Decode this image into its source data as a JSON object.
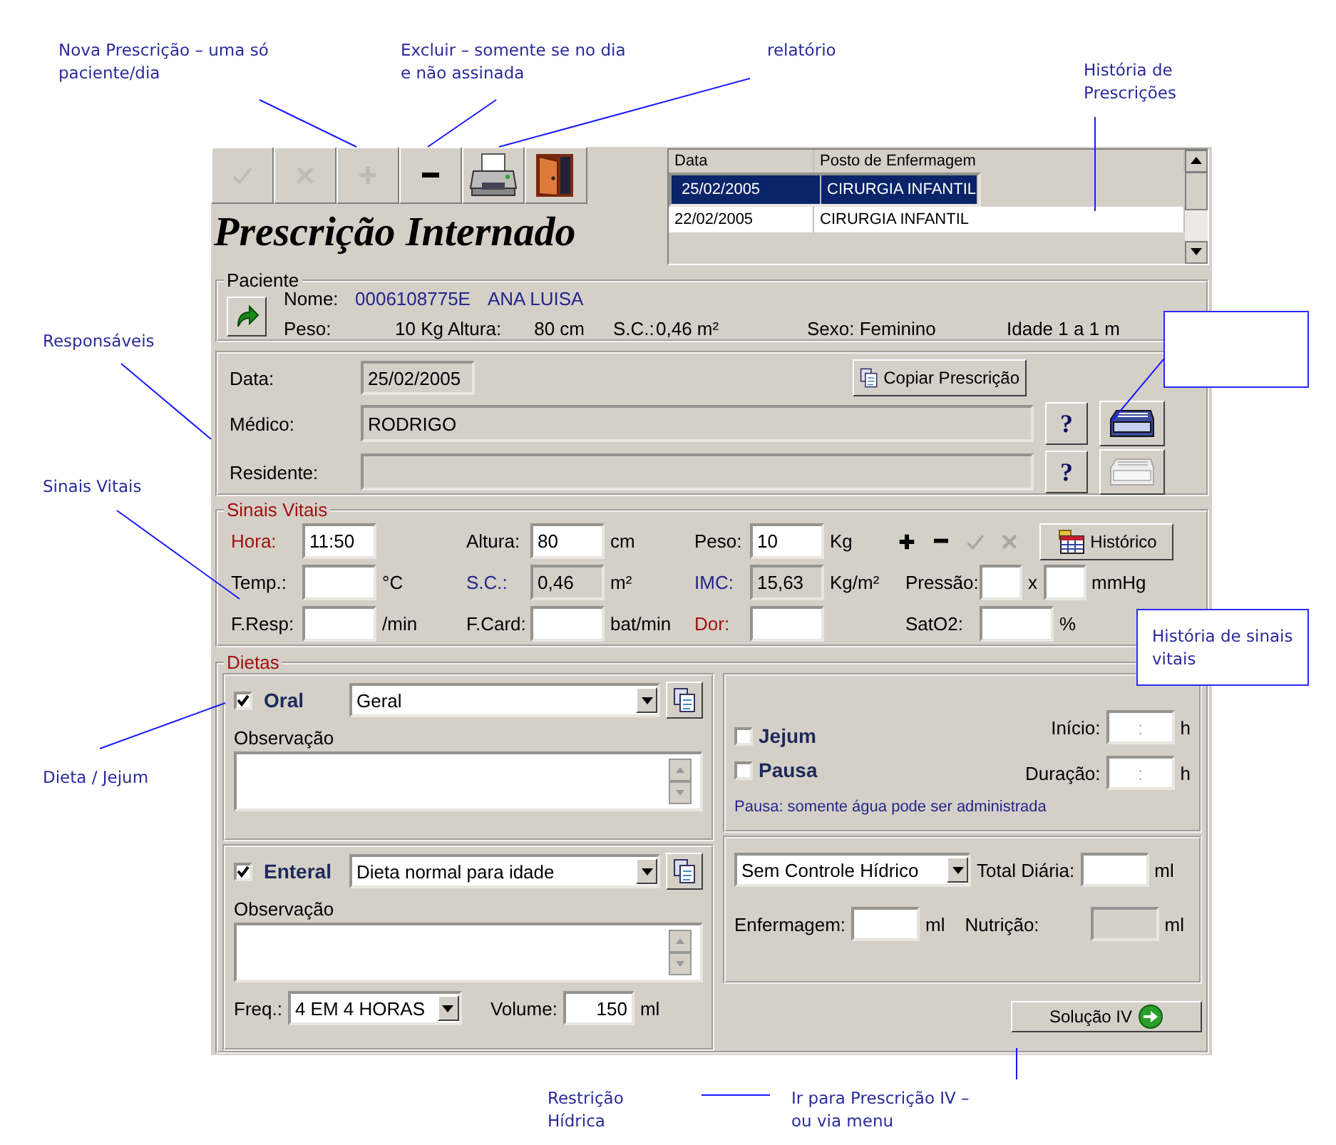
{
  "annotations": [
    {
      "text": "Nova Prescrição – uma só paciente/dia",
      "kind": "plain"
    },
    {
      "text": "Excluir – somente se no dia e não assinada",
      "kind": "plain"
    },
    {
      "text": "relatório",
      "kind": "plain"
    },
    {
      "text": "História de Prescrições",
      "kind": "plain"
    },
    {
      "text": "Responsáveis",
      "kind": "plain"
    },
    {
      "text": "Sinais Vitais",
      "kind": "plain"
    },
    {
      "text": "História de sinais vitais",
      "kind": "boxed"
    },
    {
      "text": "Dieta / Jejum",
      "kind": "plain"
    },
    {
      "text": "Restrição Hídrica",
      "kind": "plain"
    },
    {
      "text": "Ir para Prescrição IV – ou via menu",
      "kind": "plain"
    }
  ],
  "toolbar": [
    {
      "kind": "check",
      "disabled": true
    },
    {
      "kind": "cancel",
      "disabled": true
    },
    {
      "kind": "plus",
      "disabled": true
    },
    {
      "kind": "minus",
      "disabled": false
    },
    {
      "kind": "print",
      "disabled": false
    },
    {
      "kind": "exit",
      "disabled": false
    }
  ],
  "title": "Prescrição Internado",
  "history": {
    "columns": [
      "Data",
      "Posto de Enfermagem"
    ],
    "rows": [
      {
        "cells": [
          "25/02/2005",
          "CIRURGIA INFANTIL"
        ],
        "selected": true
      },
      {
        "cells": [
          "22/02/2005",
          "CIRURGIA INFANTIL"
        ],
        "selected": false
      }
    ]
  },
  "patient": {
    "legend": "Paciente",
    "nome_label": "Nome:",
    "id": "0006108775E",
    "name": "ANA LUISA",
    "peso_label": "Peso:",
    "peso": "10 Kg",
    "altura_label": "Altura:",
    "altura": "80 cm",
    "sc_label": "S.C.:",
    "sc": "0,46 m²",
    "sexo": "Sexo: Feminino",
    "idade": "Idade 1 a 1 m"
  },
  "responsaveis": {
    "data_label": "Data:",
    "data": "25/02/2005",
    "copy_button": "Copiar Prescrição",
    "rows": [
      {
        "label": "Médico:",
        "value": "RODRIGO",
        "help": "?",
        "card_disabled": false
      },
      {
        "label": "Residente:",
        "help": "?",
        "card_disabled": true
      }
    ]
  },
  "vitals": {
    "legend": "Sinais Vitais",
    "rows": [
      [
        {
          "label": "Hora:",
          "value": "11:50",
          "kind": "required"
        },
        {
          "label": "Altura:",
          "value": "80",
          "unit": "cm",
          "kind": "normal"
        },
        {
          "label": "Peso:",
          "value": "10",
          "unit": "Kg",
          "kind": "normal"
        }
      ],
      [
        {
          "label": "Temp.:",
          "unit": "°C",
          "kind": "normal"
        },
        {
          "label": "S.C.:",
          "value": "0,46",
          "unit": "m²",
          "kind": "computed"
        },
        {
          "label": "IMC:",
          "value": "15,63",
          "unit": "Kg/m²",
          "kind": "computed"
        },
        {
          "label": "Pressão:",
          "separator": "x",
          "unit": "mmHg",
          "kind": "pair"
        }
      ],
      [
        {
          "label": "F.Resp:",
          "unit": "/min",
          "kind": "normal"
        },
        {
          "label": "F.Card:",
          "unit": "bat/min",
          "kind": "normal"
        },
        {
          "label": "Dor:",
          "kind": "required"
        },
        {
          "label": "SatO2:",
          "unit": "%",
          "kind": "normal"
        }
      ]
    ],
    "tools": [
      {
        "kind": "plus",
        "disabled": false
      },
      {
        "kind": "minus",
        "disabled": false
      },
      {
        "kind": "check",
        "disabled": true
      },
      {
        "kind": "cancel",
        "disabled": true
      }
    ],
    "history_button": "Histórico"
  },
  "dietas": {
    "legend": "Dietas",
    "oral": {
      "label": "Oral",
      "checked": true,
      "select": "Geral",
      "obs_label": "Observação"
    },
    "enteral": {
      "label": "Enteral",
      "checked": true,
      "select": "Dieta normal para idade",
      "obs_label": "Observação",
      "freq_label": "Freq.:",
      "freq": "4 EM 4 HORAS",
      "volume_label": "Volume:",
      "volume": "150",
      "volume_unit": "ml"
    },
    "jejum": {
      "checks": [
        {
          "label": "Jejum",
          "checked": false
        },
        {
          "label": "Pausa",
          "checked": false
        }
      ],
      "times": [
        {
          "label": "Início:",
          "placeholder": ":",
          "unit": "h"
        },
        {
          "label": "Duração:",
          "placeholder": ":",
          "unit": "h"
        }
      ],
      "note": "Pausa: somente água pode ser administrada"
    },
    "hidrico": {
      "select": "Sem Controle Hídrico",
      "total_label": "Total Diária:",
      "total_unit": "ml",
      "enf_label": "Enfermagem:",
      "enf_unit": "ml",
      "nutri_label": "Nutrição:",
      "nutri_unit": "ml"
    },
    "iv_button": "Solução IV"
  }
}
